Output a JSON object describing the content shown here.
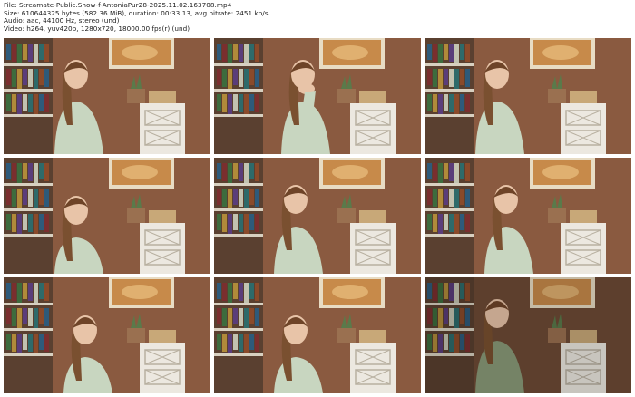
{
  "header": {
    "file": "File: Streamate-Public.Show-f-AntoniaPur28-2025.11.02.163708.mp4",
    "size": "Size: 610644325 bytes (582.36 MiB), duration: 00:33:13, avg.bitrate: 2451 kb/s",
    "audio": "Audio: aac, 44100 Hz, stereo (und)",
    "video": "Video: h264, yuv420p, 1280x720, 18000.00 fps(r) (und)"
  },
  "thumbnails": [
    {
      "pose": "front"
    },
    {
      "pose": "hand-chin"
    },
    {
      "pose": "front"
    },
    {
      "pose": "front-low"
    },
    {
      "pose": "looking-down"
    },
    {
      "pose": "looking-down"
    },
    {
      "pose": "looking-down-low"
    },
    {
      "pose": "looking-down-low"
    },
    {
      "pose": "front-dark"
    }
  ]
}
